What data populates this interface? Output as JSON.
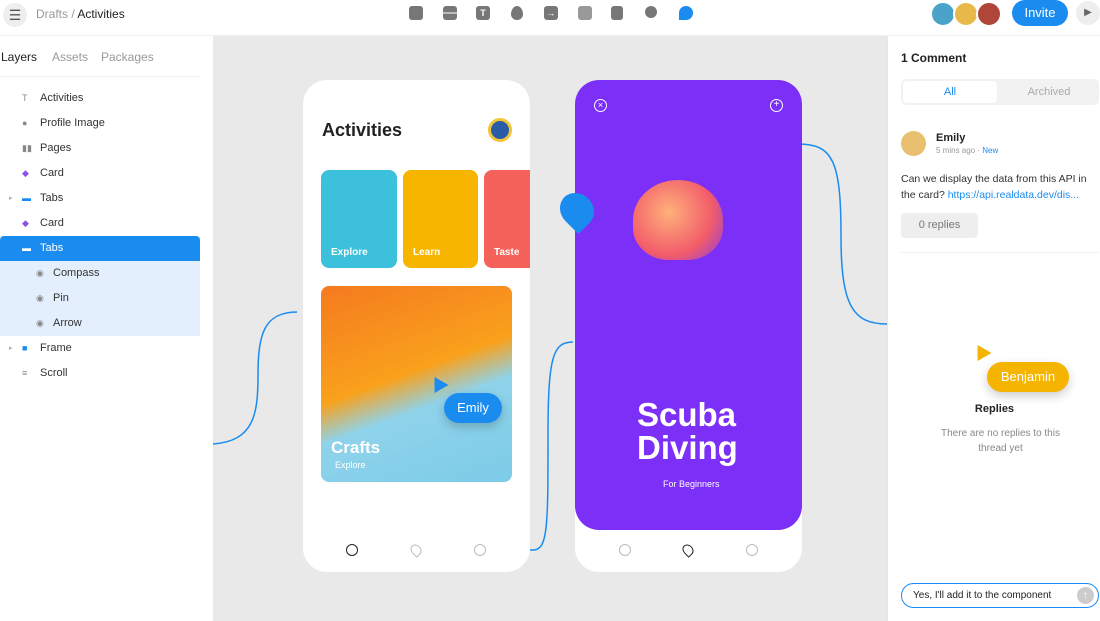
{
  "topbar": {
    "breadcrumb_parent": "Drafts /",
    "breadcrumb_current": "Activities",
    "tools": [
      "rectangle-icon",
      "stack-icon",
      "text-icon",
      "drop-icon",
      "import-icon",
      "list-icon",
      "panel-icon",
      "search-icon",
      "comment-icon"
    ],
    "invite_label": "Invite"
  },
  "layers_panel": {
    "tabs": [
      "Layers",
      "Assets",
      "Packages"
    ],
    "items": [
      {
        "label": "Activities",
        "icon": "text-icon",
        "glyph": "T"
      },
      {
        "label": "Profile Image",
        "icon": "circle-icon",
        "glyph": "●"
      },
      {
        "label": "Pages",
        "icon": "pages-icon",
        "glyph": "▮▮"
      },
      {
        "label": "Card",
        "icon": "component-icon",
        "glyph": "◆"
      },
      {
        "label": "Tabs",
        "icon": "stack-icon",
        "glyph": "▬"
      },
      {
        "label": "Card",
        "icon": "component-icon",
        "glyph": "◆"
      },
      {
        "label": "Tabs",
        "icon": "stack-icon",
        "glyph": "▬"
      },
      {
        "label": "Compass",
        "icon": "drop-icon",
        "glyph": "◉"
      },
      {
        "label": "Pin",
        "icon": "drop-icon",
        "glyph": "◉"
      },
      {
        "label": "Arrow",
        "icon": "drop-icon",
        "glyph": "◉"
      },
      {
        "label": "Frame",
        "icon": "frame-icon",
        "glyph": "■"
      },
      {
        "label": "Scroll",
        "icon": "scroll-icon",
        "glyph": "≡"
      }
    ]
  },
  "screen1": {
    "title": "Activities",
    "cards": [
      "Explore",
      "Learn",
      "Taste"
    ],
    "feature_title": "Crafts",
    "feature_sub": "Explore"
  },
  "screen2": {
    "title_line1": "Scuba",
    "title_line2": "Diving",
    "subtitle": "For Beginners"
  },
  "cursors": {
    "emily": "Emily",
    "benjamin": "Benjamin"
  },
  "comments": {
    "heading": "1 Comment",
    "tabs": [
      "All",
      "Archived"
    ],
    "author": "Emily",
    "time": "5 mins ago ·",
    "badge": "New",
    "text": "Can we display the data from this API in the card?",
    "link": "https://api.realdata.dev/dis...",
    "replies_button": "0 replies",
    "replies_heading": "Replies",
    "no_replies": "There are no replies to this thread yet",
    "reply_input": "Yes, I'll add it to the component"
  },
  "colors": {
    "accent": "#1a8cf0",
    "purple": "#7b2ff7",
    "emily": "#1a8cf0",
    "benjamin": "#f5b400"
  }
}
